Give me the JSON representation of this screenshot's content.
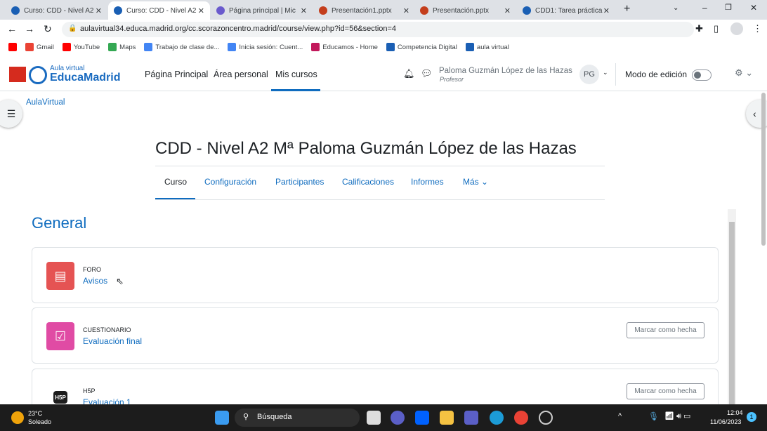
{
  "browser": {
    "tabs": [
      {
        "label": "Curso: CDD - Nivel A2",
        "icon": "moodle-icon",
        "color": "#1a5fb4"
      },
      {
        "label": "Curso: CDD - Nivel A2",
        "icon": "moodle-icon",
        "color": "#1a5fb4",
        "active": true
      },
      {
        "label": "Página principal | Mic",
        "icon": "copilot-icon",
        "color": "#6a5acd"
      },
      {
        "label": "Presentación1.pptx",
        "icon": "powerpoint-icon",
        "color": "#c43e1c"
      },
      {
        "label": "Presentación.pptx",
        "icon": "powerpoint-icon",
        "color": "#c43e1c"
      },
      {
        "label": "CDD1: Tarea práctica",
        "icon": "moodle-icon",
        "color": "#1a5fb4"
      }
    ],
    "url": "aulavirtual34.educa.madrid.org/cc.scorazoncentro.madrid/course/view.php?id=56&section=4",
    "bookmarks": [
      {
        "label": "",
        "icon": "youtube-icon",
        "color": "#ff0000"
      },
      {
        "label": "Gmail",
        "icon": "gmail-icon",
        "color": "#ea4335"
      },
      {
        "label": "YouTube",
        "icon": "youtube-icon",
        "color": "#ff0000"
      },
      {
        "label": "Maps",
        "icon": "maps-icon",
        "color": "#34a853"
      },
      {
        "label": "Trabajo de clase de...",
        "icon": "google-icon",
        "color": "#4285f4"
      },
      {
        "label": "Inicia sesión: Cuent...",
        "icon": "google-icon",
        "color": "#4285f4"
      },
      {
        "label": "Educamos - Home",
        "icon": "educamos-icon",
        "color": "#c2185b"
      },
      {
        "label": "Competencia Digital",
        "icon": "moodle-icon",
        "color": "#1a5fb4"
      },
      {
        "label": "aula virtual",
        "icon": "moodle-icon",
        "color": "#1a5fb4"
      }
    ]
  },
  "site": {
    "logo_small": "Aula virtual",
    "logo_big": "EducaMadrid",
    "nav": [
      "Página Principal",
      "Área personal",
      "Mis cursos"
    ],
    "user_name": "Paloma Guzmán López de las Hazas",
    "user_role": "Profesor",
    "user_initials": "PG",
    "edit_mode": "Modo de edición",
    "edit_mode_on": false,
    "breadcrumb": "AulaVirtual"
  },
  "course": {
    "title": "CDD - Nivel A2 Mª Paloma Guzmán López de las Hazas",
    "tabs": [
      "Curso",
      "Configuración",
      "Participantes",
      "Calificaciones",
      "Informes",
      "Más"
    ],
    "active_tab": "Curso",
    "section": "General",
    "activities": [
      {
        "type": "FORO",
        "name": "Avisos",
        "icon": "forum-icon",
        "color": "#e55353",
        "button": ""
      },
      {
        "type": "CUESTIONARIO",
        "name": "Evaluación final",
        "icon": "quiz-icon",
        "color": "#e04ba4",
        "button": "Marcar como hecha"
      },
      {
        "type": "H5P",
        "name": "Evaluación 1",
        "icon": "h5p-icon",
        "color": "#1d1d1d",
        "button": "Marcar como hecha"
      }
    ]
  },
  "taskbar": {
    "temp": "23°C",
    "weather": "Soleado",
    "search": "Búsqueda",
    "time": "12:04",
    "date": "11/06/2023",
    "badge": "1"
  }
}
